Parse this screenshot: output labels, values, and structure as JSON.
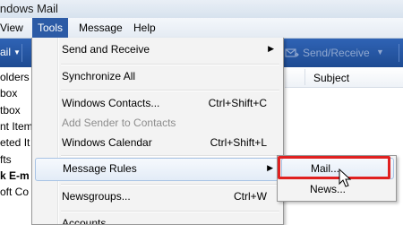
{
  "window": {
    "title": "indows Mail"
  },
  "menubar": {
    "items": [
      {
        "label": "View"
      },
      {
        "label": "Tools"
      },
      {
        "label": "Message"
      },
      {
        "label": "Help"
      }
    ]
  },
  "toolbar": {
    "mail_label": "ail",
    "send_receive_label": "Send/Receive"
  },
  "folders": [
    {
      "label": "olders"
    },
    {
      "label": "box"
    },
    {
      "label": "tbox"
    },
    {
      "label": "nt Item"
    },
    {
      "label": "eted It"
    },
    {
      "label": "fts"
    },
    {
      "label": "k E-m"
    },
    {
      "label": "oft Co"
    }
  ],
  "message_list": {
    "subject_header": "Subject"
  },
  "tools_menu": {
    "items": [
      {
        "label": "Send and Receive",
        "shortcut": ""
      },
      {
        "label": "Synchronize All",
        "shortcut": ""
      },
      {
        "label": "Windows Contacts...",
        "shortcut": "Ctrl+Shift+C"
      },
      {
        "label": "Add Sender to Contacts",
        "shortcut": ""
      },
      {
        "label": "Windows Calendar",
        "shortcut": "Ctrl+Shift+L"
      },
      {
        "label": "Message Rules",
        "shortcut": ""
      },
      {
        "label": "Newsgroups...",
        "shortcut": "Ctrl+W"
      },
      {
        "label": "Accounts",
        "shortcut": ""
      }
    ]
  },
  "rules_submenu": {
    "items": [
      {
        "label": "Mail..."
      },
      {
        "label": "News..."
      }
    ]
  },
  "colors": {
    "toolbar": "#2a5aa8",
    "menu_active": "#2c5ba6",
    "highlight_box": "#e02020"
  }
}
